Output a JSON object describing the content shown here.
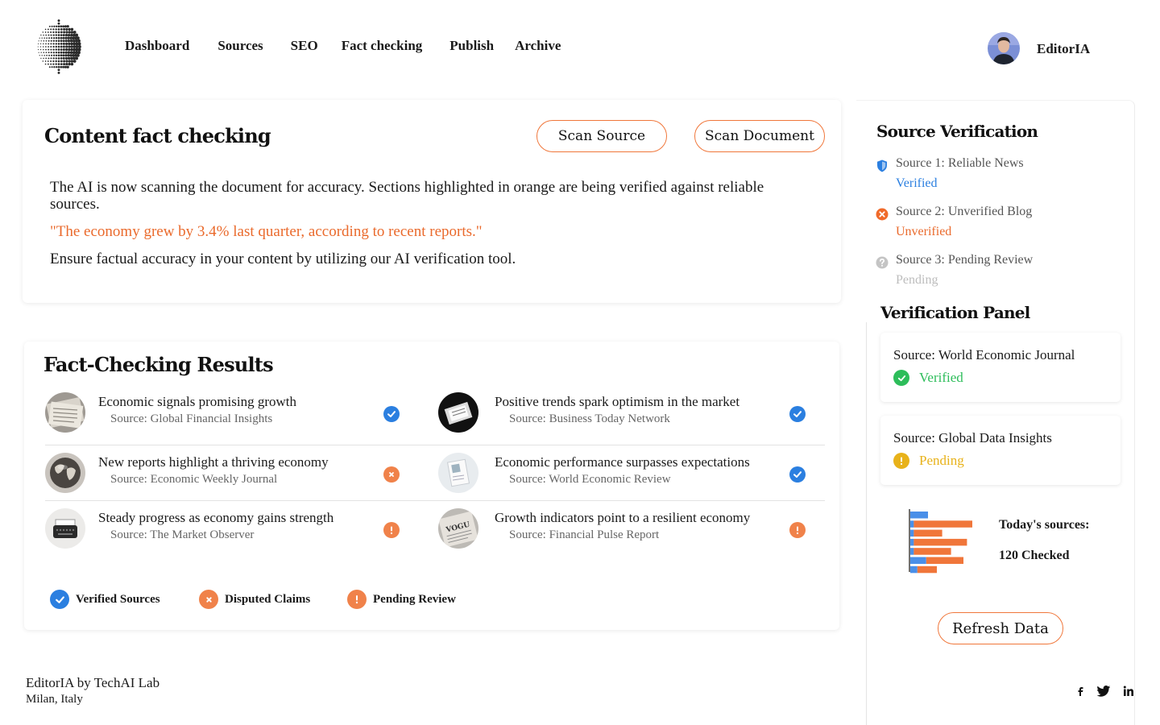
{
  "colors": {
    "accent_orange": "#f0763a",
    "verified_blue": "#2b7fe0",
    "disputed_orange": "#f0824a",
    "pending_orange": "#f0824a",
    "verified_green": "#2dbd5a",
    "pending_yellow": "#e8b21a"
  },
  "nav": {
    "items": [
      "Dashboard",
      "Sources",
      "SEO",
      "Fact checking",
      "Publish",
      "Archive"
    ]
  },
  "user": {
    "name": "EditorIA"
  },
  "fact_check": {
    "title": "Content fact checking",
    "scan_source_label": "Scan Source",
    "scan_document_label": "Scan Document",
    "intro": "The AI is now scanning the document for accuracy. Sections highlighted in orange are being verified against reliable sources.",
    "highlighted_quote": "\"The economy grew by 3.4% last quarter, according to recent reports.\"",
    "closing": "Ensure factual accuracy in your content by utilizing our AI verification tool."
  },
  "results": {
    "title": "Fact-Checking Results",
    "items": [
      {
        "title": "Economic signals promising growth",
        "source": "Source: Global Financial Insights",
        "status": "verified",
        "thumb": "newspaper-stack"
      },
      {
        "title": "Positive trends spark optimism in the market",
        "source": "Source: Business Today Network",
        "status": "verified",
        "thumb": "tablet-news"
      },
      {
        "title": "New reports highlight a thriving economy",
        "source": "Source: Economic Weekly Journal",
        "status": "disputed",
        "thumb": "globe"
      },
      {
        "title": "Economic performance surpasses expectations",
        "source": "Source: World Economic Review",
        "status": "verified",
        "thumb": "magazine"
      },
      {
        "title": "Steady progress as economy gains strength",
        "source": "Source: The Market Observer",
        "status": "pending",
        "thumb": "typewriter"
      },
      {
        "title": "Growth indicators point to a resilient economy",
        "source": "Source: Financial Pulse Report",
        "status": "pending",
        "thumb": "newspaper-vogue"
      }
    ],
    "legend": {
      "verified": "Verified Sources",
      "disputed": "Disputed Claims",
      "pending": "Pending Review"
    }
  },
  "footer": {
    "name": "EditorIA by TechAI Lab",
    "location": "Milan, Italy",
    "social": [
      "facebook-icon",
      "twitter-icon",
      "linkedin-icon"
    ]
  },
  "source_verification": {
    "title": "Source Verification",
    "items": [
      {
        "name": "Source 1: Reliable News",
        "status": "Verified",
        "icon": "shield-icon"
      },
      {
        "name": "Source 2: Unverified Blog",
        "status": "Unverified",
        "icon": "x-circle-icon"
      },
      {
        "name": "Source 3: Pending Review",
        "status": "Pending",
        "icon": "question-circle-icon"
      }
    ]
  },
  "verification_panel": {
    "title": "Verification Panel",
    "cards": [
      {
        "source": "Source: World Economic Journal",
        "status": "Verified"
      },
      {
        "source": "Source: Global Data Insights",
        "status": "Pending"
      }
    ]
  },
  "stats": {
    "today_label": "Today's sources:",
    "today_count": "120 Checked",
    "refresh_label": "Refresh Data"
  },
  "chart_data": {
    "type": "bar",
    "orientation": "horizontal",
    "stacked": true,
    "series": [
      {
        "values": [
          20,
          4,
          4,
          4,
          4,
          18,
          8
        ]
      },
      {
        "values": [
          0,
          66,
          32,
          60,
          42,
          42,
          22
        ]
      }
    ],
    "colors": [
      "#4a8fe8",
      "#f0763a"
    ]
  }
}
